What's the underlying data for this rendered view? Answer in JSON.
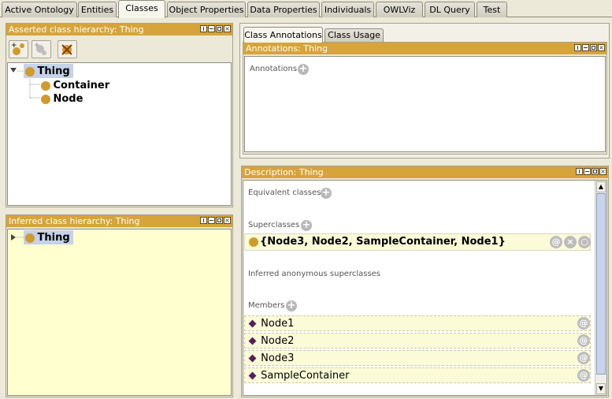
{
  "tabs": [
    {
      "label": "Active Ontology",
      "active": false
    },
    {
      "label": "Entities",
      "active": false
    },
    {
      "label": "Classes",
      "active": true
    },
    {
      "label": "Object Properties",
      "active": false
    },
    {
      "label": "Data Properties",
      "active": false
    },
    {
      "label": "Individuals",
      "active": false
    },
    {
      "label": "OWLViz",
      "active": false
    },
    {
      "label": "DL Query",
      "active": false
    },
    {
      "label": "Test",
      "active": false
    }
  ],
  "asserted": {
    "title": "Asserted class hierarchy: Thing",
    "root": "Thing",
    "children": [
      "Container",
      "Node"
    ]
  },
  "inferred": {
    "title": "Inferred class hierarchy: Thing",
    "root": "Thing"
  },
  "subtabs": [
    {
      "label": "Class Annotations",
      "active": true
    },
    {
      "label": "Class Usage",
      "active": false
    }
  ],
  "annotations": {
    "title": "Annotations: Thing",
    "label": "Annotations"
  },
  "description": {
    "title": "Description: Thing",
    "equivalent_label": "Equivalent classes",
    "superclasses_label": "Superclasses",
    "superclass_value": "{Node3, Node2, SampleContainer, Node1}",
    "inferred_label": "Inferred anonymous superclasses",
    "members_label": "Members",
    "members": [
      "Node1",
      "Node2",
      "Node3",
      "SampleContainer"
    ]
  },
  "colors": {
    "panel_header": "#d6a43a",
    "class_icon": "#cf9b2c",
    "individual_icon": "#5a1f5a",
    "inferred_bg": "#ffffd0"
  },
  "icons": {
    "add_subclass": "add-subclass-icon",
    "add_sibling": "add-sibling-icon",
    "delete_class": "delete-class-icon"
  }
}
